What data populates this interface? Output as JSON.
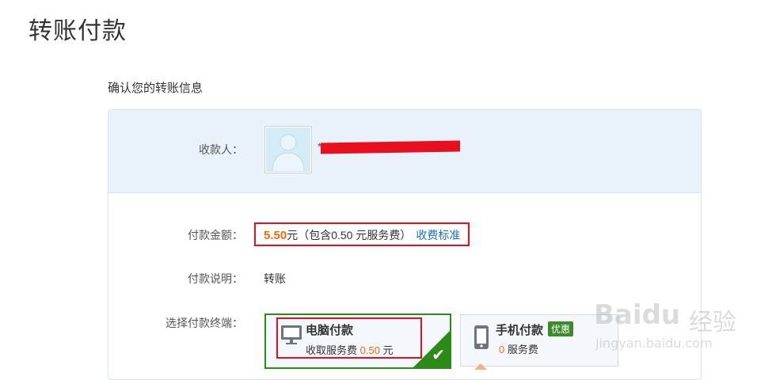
{
  "page": {
    "title": "转账付款"
  },
  "section": {
    "title": "确认您的转账信息"
  },
  "payee": {
    "label": "收款人：",
    "name_prefix": "*"
  },
  "amount": {
    "label": "付款金额：",
    "value": "5.50",
    "currency": "元",
    "fee_prefix": "（包含",
    "fee_value": "0.50",
    "fee_suffix": " 元服务费）",
    "link": "收费标准"
  },
  "note": {
    "label": "付款说明：",
    "value": "转账"
  },
  "terminal": {
    "label": "选择付款终端：",
    "options": [
      {
        "title": "电脑付款",
        "sub_prefix": "收取服务费 ",
        "fee": "0.50",
        "sub_suffix": " 元",
        "selected": true
      },
      {
        "title": "手机付款",
        "badge": "优惠",
        "fee": "0",
        "sub_suffix": " 服务费",
        "selected": false
      }
    ]
  },
  "watermark": {
    "brand": "Baidu",
    "cn": "经验",
    "url": "jingyan.baidu.com"
  },
  "colors": {
    "accent_orange": "#f26b10",
    "link_blue": "#1f6fb5",
    "selected_green": "#2d8a18",
    "highlight_red": "#e8101e"
  },
  "icons": {
    "pc": "monitor-icon",
    "mobile": "phone-icon",
    "check": "check-icon",
    "avatar": "user-avatar-icon"
  }
}
